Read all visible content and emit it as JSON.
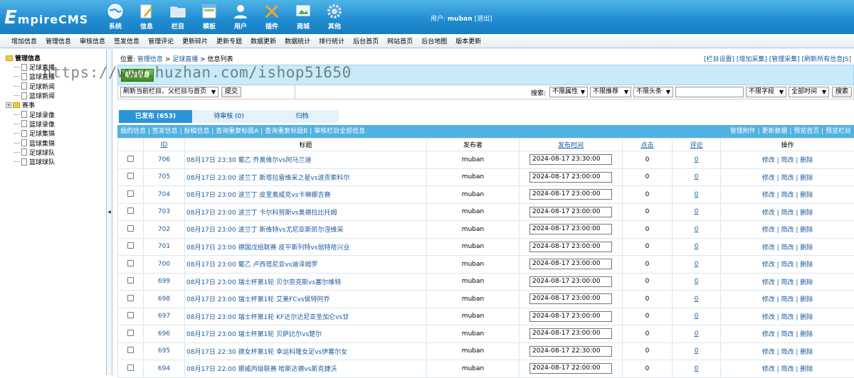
{
  "app": {
    "logo_first": "E",
    "logo_rest": "mpireCMS"
  },
  "topnav": [
    {
      "label": "系统",
      "icon": "globe-icon"
    },
    {
      "label": "信息",
      "icon": "pencil-doc-icon"
    },
    {
      "label": "栏目",
      "icon": "folder-icon"
    },
    {
      "label": "模板",
      "icon": "template-window-icon"
    },
    {
      "label": "用户",
      "icon": "user-icon"
    },
    {
      "label": "插件",
      "icon": "tools-icon"
    },
    {
      "label": "商城",
      "icon": "shop-screen-icon"
    },
    {
      "label": "其他",
      "icon": "gear-icon"
    }
  ],
  "user": {
    "prefix": "用户:",
    "name": "muban",
    "logout": "[退出]"
  },
  "menubar": [
    "增加信息",
    "管理信息",
    "审核信息",
    "签发信息",
    "管理评论",
    "更新碎片",
    "更新专题",
    "数据更新",
    "数据统计",
    "排行统计",
    "后台首页",
    "网站首页",
    "后台地图",
    "版本更新"
  ],
  "sidebar": {
    "root": "管理信息",
    "items": [
      "足球直播",
      "篮球直播",
      "足球新闻",
      "篮球新闻"
    ],
    "folder": "赛事",
    "folder_items": [
      "足球录像",
      "篮球录像",
      "足球集锦",
      "篮球集锦",
      "足球球队",
      "篮球球队"
    ]
  },
  "breadcrumb": {
    "prefix": "位置:",
    "c1": "管理信息",
    "sep": ">",
    "c2": "足球直播",
    "c3": "信息列表"
  },
  "toplinks": "[栏目设置] [增加采集] [管理采集] [刷新所有信息JS]",
  "add_button": "增加信息",
  "refresh_select": "刷新当前栏目、父栏目与首页",
  "submit_button": "提交",
  "search": {
    "label": "搜索:",
    "attr": "不限属性",
    "recommend": "不限推荐",
    "headline": "不限头条",
    "field": "不限字段",
    "time": "全部时间",
    "button": "搜索"
  },
  "tabs": [
    "已发布 (653)",
    "待审核 (0)",
    "归档"
  ],
  "actionbar": {
    "left": "我的信息 | 签发信息 | 投稿信息 | 查询重复标题A | 查询重复标题B | 审核栏目全部信息",
    "right": "管理附件 | 更新数据 | 预览首页 | 预览栏目"
  },
  "columns": {
    "id": "ID",
    "title": "标题",
    "author": "发布者",
    "time": "发布时间",
    "clicks": "点击",
    "comments": "评论",
    "ops": "操作"
  },
  "ops_text": "修改 | 简改 | 删除",
  "rows": [
    {
      "id": "706",
      "title": "08月17日 23:30 葡乙 乔奥维尔vs阿马兰迪",
      "author": "muban",
      "time": "2024-08-17 23:30:00",
      "clicks": "0",
      "comments": "0"
    },
    {
      "id": "705",
      "title": "08月17日 23:00 波兰丁 斯塔拉雷维采之星vs波贡索科尔",
      "author": "muban",
      "time": "2024-08-17 23:00:00",
      "clicks": "0",
      "comments": "0"
    },
    {
      "id": "704",
      "title": "08月17日 23:00 波兰丁 皮里奥威克vs卡琳娜吉赛",
      "author": "muban",
      "time": "2024-08-17 23:00:00",
      "clicks": "0",
      "comments": "0"
    },
    {
      "id": "703",
      "title": "08月17日 23:00 波兰丁 卡尔科努斯vs奥德拉比托姆",
      "author": "muban",
      "time": "2024-08-17 23:00:00",
      "clicks": "0",
      "comments": "0"
    },
    {
      "id": "702",
      "title": "08月17日 23:00 波兰丁 斯维特vs尤尼亚斯凯尔涅维采",
      "author": "muban",
      "time": "2024-08-17 23:00:00",
      "clicks": "0",
      "comments": "0"
    },
    {
      "id": "701",
      "title": "08月17日 23:00 德国戊组联赛 皮平斯列特vs翁特哈兴业",
      "author": "muban",
      "time": "2024-08-17 23:00:00",
      "clicks": "0",
      "comments": "0"
    },
    {
      "id": "700",
      "title": "08月17日 23:00 葡乙 卢西塔尼亚vs迪泽姆罗",
      "author": "muban",
      "time": "2024-08-17 23:00:00",
      "clicks": "0",
      "comments": "0"
    },
    {
      "id": "699",
      "title": "08月17日 23:00 瑞士杯第1轮 贝尔奈克斯vs塞尔维特",
      "author": "muban",
      "time": "2024-08-17 23:00:00",
      "clicks": "0",
      "comments": "0"
    },
    {
      "id": "698",
      "title": "08月17日 23:00 瑞士杯第1轮 艾美FCvs侯特阿乔",
      "author": "muban",
      "time": "2024-08-17 23:00:00",
      "clicks": "0",
      "comments": "0"
    },
    {
      "id": "697",
      "title": "08月17日 23:00 瑞士杯第1轮 KF达尔达尼亚圣加仑vs甘",
      "author": "muban",
      "time": "2024-08-17 23:00:00",
      "clicks": "0",
      "comments": "0"
    },
    {
      "id": "696",
      "title": "08月17日 23:00 瑞士杯第1轮 贝萨比尔vs楚尔",
      "author": "muban",
      "time": "2024-08-17 23:00:00",
      "clicks": "0",
      "comments": "0"
    },
    {
      "id": "695",
      "title": "08月17日 22:30 德女杯第1轮 幸运科隆女足vs伊塞尔女",
      "author": "muban",
      "time": "2024-08-17 22:30:00",
      "clicks": "0",
      "comments": "0"
    },
    {
      "id": "694",
      "title": "08月17日 22:00 挪威丙级联赛 哈斯达德vs斯克捷沃",
      "author": "muban",
      "time": "2024-08-17 22:00:00",
      "clicks": "0",
      "comments": "0"
    }
  ],
  "watermark": "https://www.huzhan.com/ishop51650"
}
